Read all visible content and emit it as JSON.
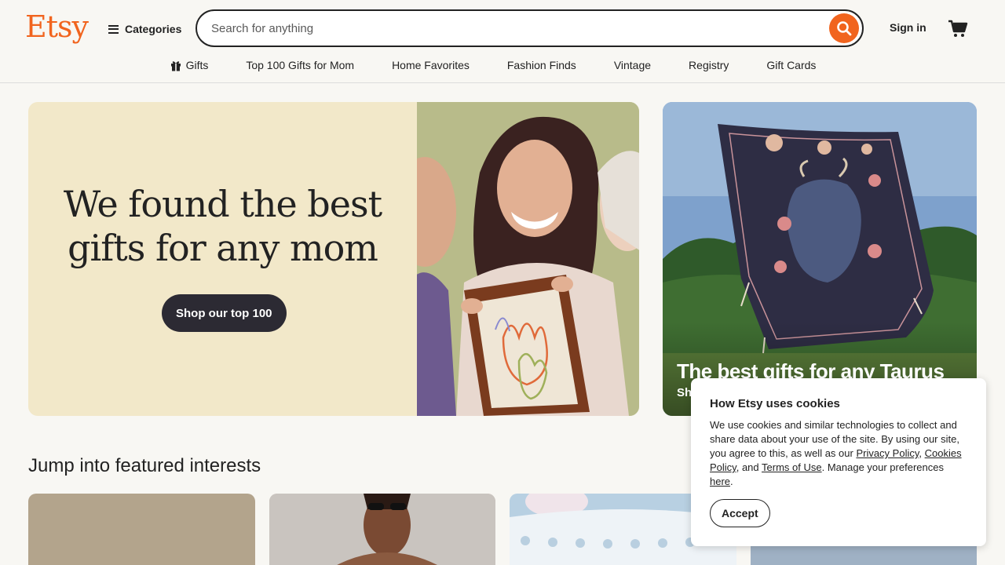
{
  "header": {
    "logo": "Etsy",
    "categories_label": "Categories",
    "search_placeholder": "Search for anything",
    "signin_label": "Sign in"
  },
  "nav": {
    "items": [
      "Gifts",
      "Top 100 Gifts for Mom",
      "Home Favorites",
      "Fashion Finds",
      "Vintage",
      "Registry",
      "Gift Cards"
    ]
  },
  "hero": {
    "title_line1": "We found the best",
    "title_line2": "gifts for any mom",
    "button_label": "Shop our top 100"
  },
  "side_card": {
    "title": "The best gifts for any Taurus",
    "subtitle": "Sh"
  },
  "featured": {
    "title": "Jump into featured interests"
  },
  "cookie": {
    "title": "How Etsy uses cookies",
    "body_start": "We use cookies and similar technologies to collect and share data about your use of the site. By using our site, you agree to this, as well as our ",
    "privacy_link": "Privacy Policy",
    "sep1": ", ",
    "cookies_link": "Cookies Policy",
    "sep2": ", and ",
    "terms_link": "Terms of Use",
    "body_mid": ". Manage your preferences ",
    "here_link": "here",
    "body_end": ".",
    "accept_label": "Accept"
  },
  "colors": {
    "brand": "#f1641e",
    "hero_bg": "#f2e8c9",
    "dark_button": "#2c2a33"
  }
}
